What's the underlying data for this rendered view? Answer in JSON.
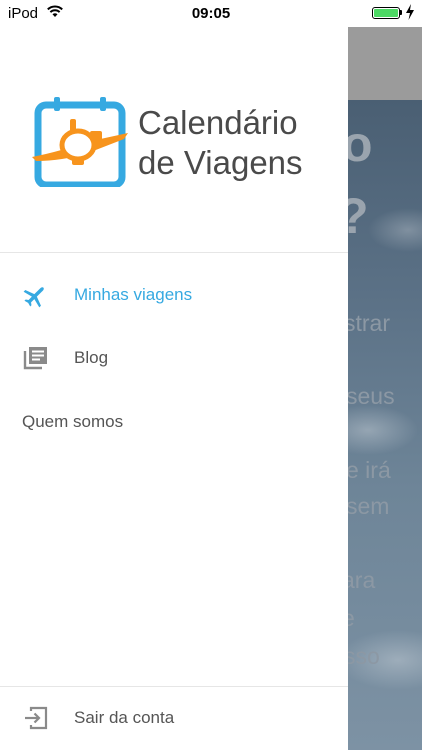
{
  "status": {
    "carrier": "iPod",
    "time": "09:05"
  },
  "app": {
    "logo_line1": "Calendário",
    "logo_line2": "de Viagens"
  },
  "menu": {
    "items": [
      {
        "label": "Minhas viagens",
        "icon": "airplane-icon",
        "active": true
      },
      {
        "label": "Blog",
        "icon": "newspaper-icon",
        "active": false
      }
    ],
    "about": "Quem somos",
    "logout": "Sair da conta"
  },
  "background": {
    "fragments": [
      "o",
      "?",
      "strar",
      "seus",
      "e irá",
      "sem",
      "ara",
      "e",
      "sso"
    ]
  },
  "colors": {
    "accent": "#36a9e1",
    "logo_orange": "#f7941d",
    "logo_blue": "#36a9e1"
  }
}
